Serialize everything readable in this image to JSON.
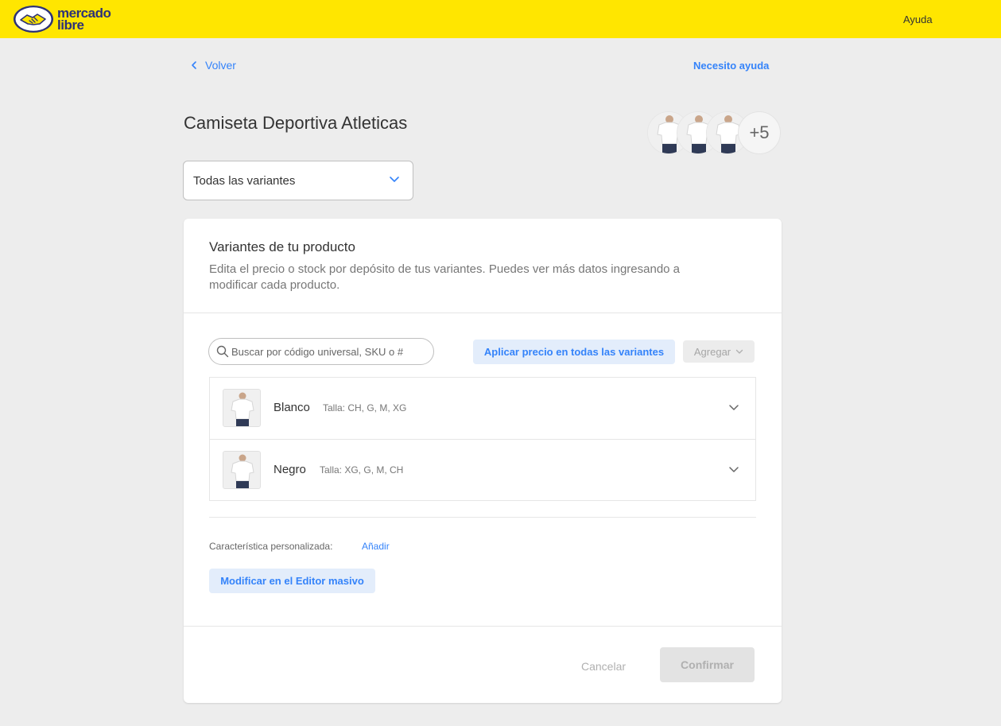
{
  "topbar": {
    "logo_line1": "mercado",
    "logo_line2": "libre",
    "help_label": "Ayuda",
    "background": "#ffe600",
    "logo_color": "#2d3277"
  },
  "nav": {
    "back_label": "Volver",
    "need_help_label": "Necesito ayuda"
  },
  "product": {
    "title": "Camiseta Deportiva Atleticas",
    "more_photos_label": "+5"
  },
  "variant_filter": {
    "selected": "Todas las variantes"
  },
  "card": {
    "title": "Variantes de tu producto",
    "description": "Edita el precio o stock por depósito de tus variantes. Puedes ver más datos ingresando a modificar cada producto.",
    "search_placeholder": "Buscar por código universal, SKU o #",
    "apply_price_label": "Aplicar precio en todas las variantes",
    "add_label": "Agregar",
    "variants": [
      {
        "name": "Blanco",
        "sizes": "Talla: CH, G, M, XG"
      },
      {
        "name": "Negro",
        "sizes": "Talla: XG, G, M, CH"
      }
    ],
    "custom_feature_label": "Característica personalizada:",
    "custom_feature_add": "Añadir",
    "mass_editor_label": "Modificar en el Editor masivo",
    "cancel_label": "Cancelar",
    "confirm_label": "Confirmar"
  },
  "colors": {
    "accent": "#3483fa",
    "accent_light": "#e3edfb",
    "page_background": "#ededed"
  },
  "icons": {
    "logo": "handshake-icon",
    "back": "chevron-left-icon",
    "dropdown": "chevron-down-icon",
    "search": "search-icon"
  }
}
